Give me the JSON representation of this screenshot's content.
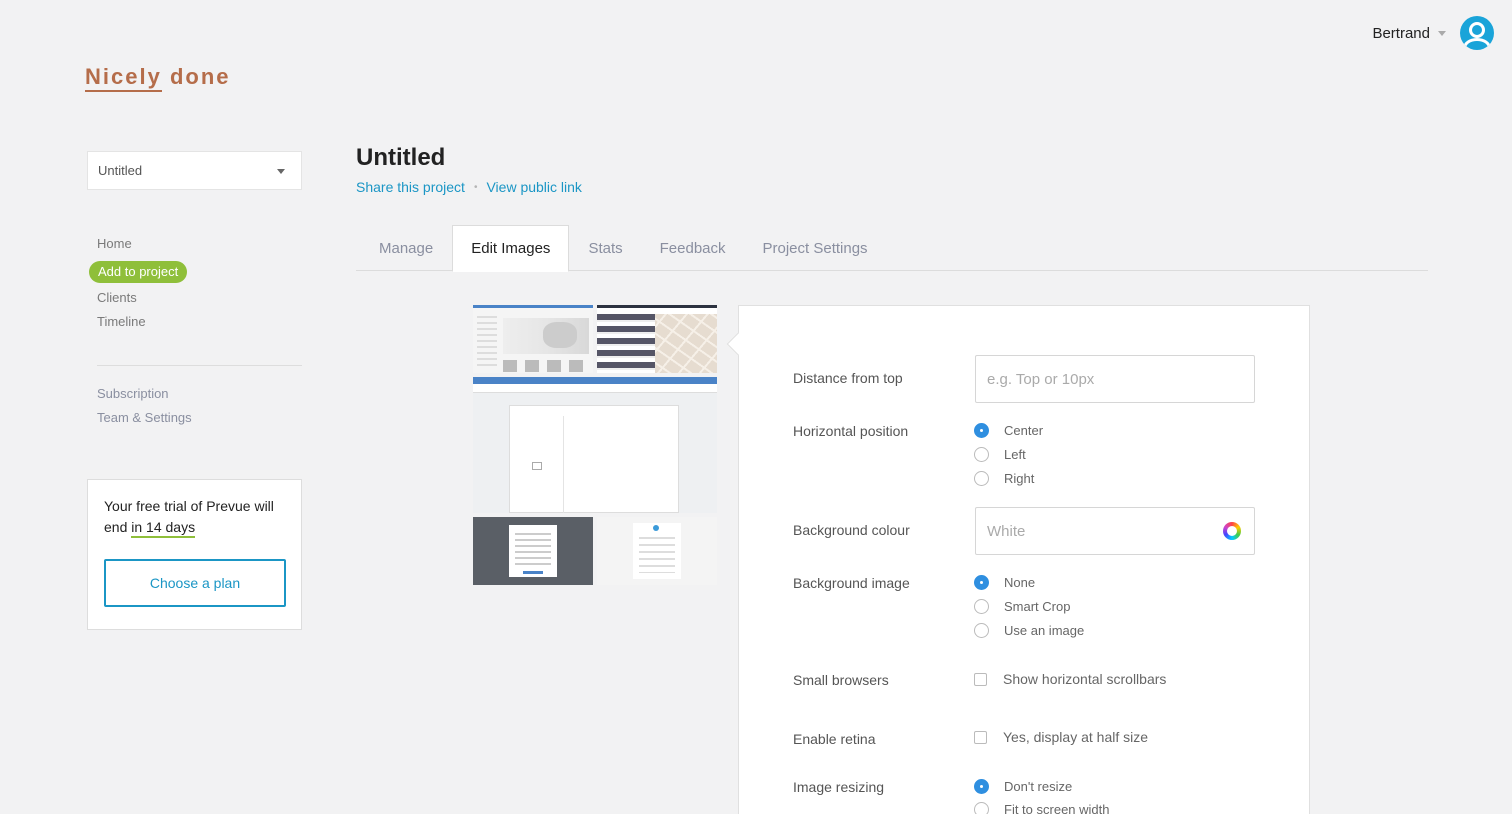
{
  "header": {
    "user_name": "Bertrand",
    "avatar_icon": "user-avatar-icon"
  },
  "brand": {
    "logo_part1": "Nicely",
    "logo_part2": " done",
    "color": "#b56d4a"
  },
  "sidebar": {
    "project_select": "Untitled",
    "items": [
      {
        "label": "Home",
        "active": false
      },
      {
        "label": "Add to project",
        "active": true
      },
      {
        "label": "Clients",
        "active": false
      },
      {
        "label": "Timeline",
        "active": false
      }
    ],
    "items2": [
      {
        "label": "Subscription"
      },
      {
        "label": "Team & Settings"
      }
    ],
    "trial": {
      "text": "Your free trial of Prevue will end ",
      "days": "in 14 days",
      "button": "Choose a plan"
    }
  },
  "project": {
    "title": "Untitled",
    "share_link": "Share this project",
    "separator": "•",
    "public_link": "View public link"
  },
  "tabs": [
    {
      "label": "Manage",
      "active": false
    },
    {
      "label": "Edit Images",
      "active": true
    },
    {
      "label": "Stats",
      "active": false
    },
    {
      "label": "Feedback",
      "active": false
    },
    {
      "label": "Project Settings",
      "active": false
    }
  ],
  "settings": {
    "distance_label": "Distance from top",
    "distance_placeholder": "e.g. Top or 10px",
    "hpos_label": "Horizontal position",
    "hpos_options": [
      {
        "label": "Center",
        "selected": true
      },
      {
        "label": "Left",
        "selected": false
      },
      {
        "label": "Right",
        "selected": false
      }
    ],
    "bgcolour_label": "Background colour",
    "bgcolour_value": "White",
    "bgimage_label": "Background image",
    "bgimage_options": [
      {
        "label": "None",
        "selected": true
      },
      {
        "label": "Smart Crop",
        "selected": false
      },
      {
        "label": "Use an image",
        "selected": false
      }
    ],
    "small_label": "Small browsers",
    "small_option": "Show horizontal scrollbars",
    "retina_label": "Enable retina",
    "retina_option": "Yes, display at half size",
    "resize_label": "Image resizing",
    "resize_options": [
      {
        "label": "Don't resize",
        "selected": true
      },
      {
        "label": "Fit to screen width",
        "selected": false
      }
    ]
  },
  "colors": {
    "accent_blue": "#1b96c5",
    "accent_green": "#8fbf3a",
    "radio_blue": "#2f8fe0"
  }
}
